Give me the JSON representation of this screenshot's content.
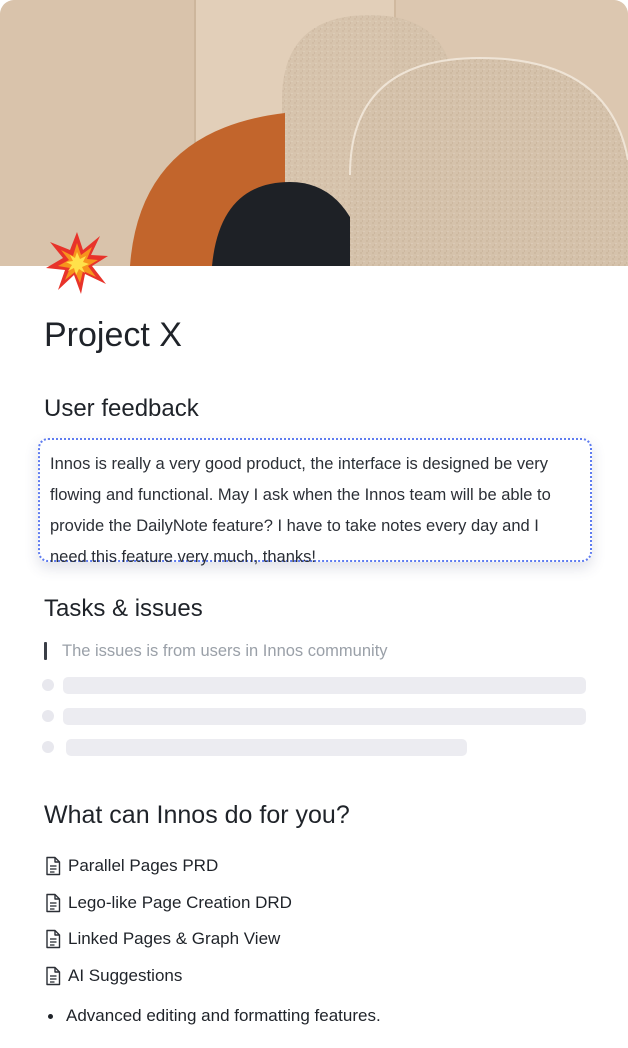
{
  "page": {
    "cover_image": "abstract-arches-cover",
    "emoji": "collision-icon",
    "title": "Project X"
  },
  "feedback_section": {
    "heading": "User feedback",
    "text": "Innos is really a very good product, the interface is designed be very flowing and functional. May I ask when the Innos team will be able to provide the DailyNote feature? I have to take notes every day and I need this feature very much, thanks!"
  },
  "tasks_section": {
    "heading": "Tasks & issues",
    "quote": "The issues is from users in Innos community"
  },
  "features_section": {
    "heading": "What can Innos do for you?",
    "pages": [
      {
        "label": "Parallel Pages PRD",
        "icon": "document-icon"
      },
      {
        "label": "Lego-like Page Creation DRD",
        "icon": "document-icon"
      },
      {
        "label": "Linked Pages & Graph View",
        "icon": "document-icon"
      },
      {
        "label": "AI Suggestions",
        "icon": "document-icon"
      }
    ],
    "bullets": [
      "Advanced editing and formatting features."
    ]
  },
  "colors": {
    "focus_border": "#5f7cf0",
    "skeleton": "#ececf1",
    "muted_text": "#9aa0a8"
  }
}
